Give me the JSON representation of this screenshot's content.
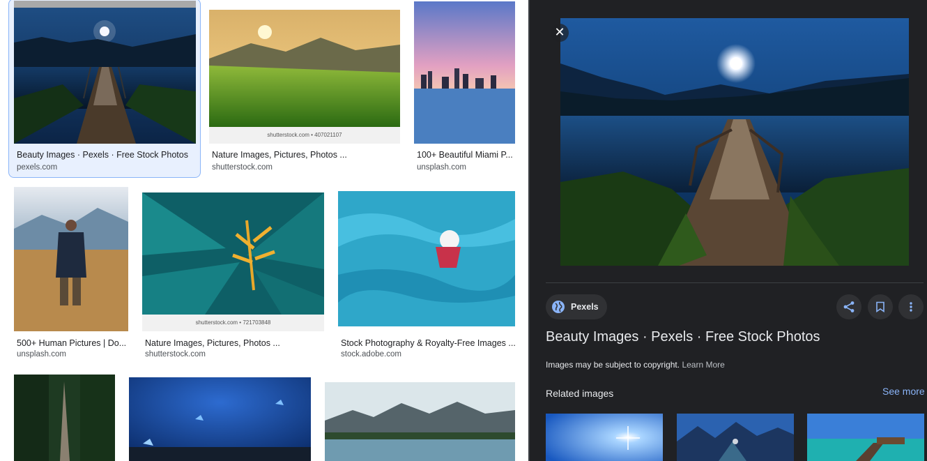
{
  "results": [
    {
      "title": "Beauty Images · Pexels · Free Stock Photos",
      "source": "pexels.com"
    },
    {
      "title": "Nature Images, Pictures, Photos ...",
      "source": "shutterstock.com",
      "watermark": "shutterstock.com • 407021107"
    },
    {
      "title": "100+ Beautiful Miami P...",
      "source": "unsplash.com"
    },
    {
      "title": "500+ Human Pictures | Do...",
      "source": "unsplash.com"
    },
    {
      "title": "Nature Images, Pictures, Photos ...",
      "source": "shutterstock.com",
      "watermark": "shutterstock.com • 721703848"
    },
    {
      "title": "Stock Photography & Royalty-Free Images ...",
      "source": "stock.adobe.com"
    }
  ],
  "panel": {
    "close_icon": "close-icon",
    "source_name": "Pexels",
    "title": "Beauty Images · Pexels · Free Stock Photos",
    "copyright_text": "Images may be subject to copyright.",
    "learn_more": "Learn More",
    "related_heading": "Related images",
    "see_more": "See more"
  },
  "colors": {
    "accent": "#8ab4f8",
    "panel_bg": "#202124",
    "chip_bg": "#303134"
  }
}
